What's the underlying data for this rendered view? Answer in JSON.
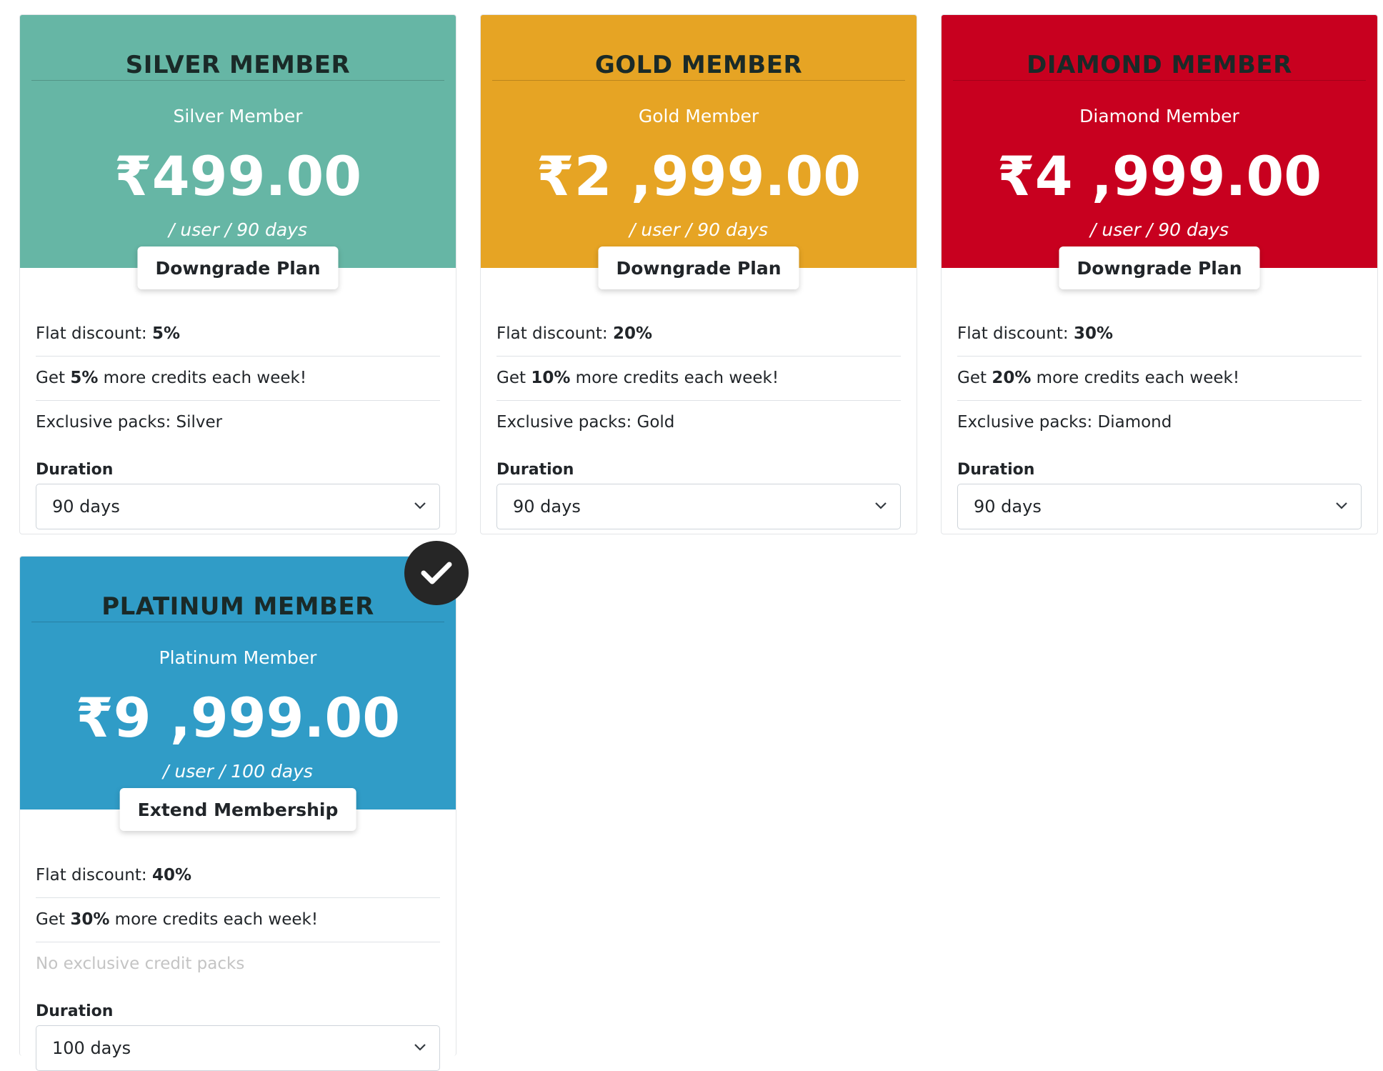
{
  "plans": [
    {
      "title": "SILVER MEMBER",
      "subtitle": "Silver Member",
      "price": "₹499.00",
      "period": "/ user / 90 days",
      "action_label": "Downgrade Plan",
      "accent_color": "#66b6a5",
      "features": [
        {
          "prefix": "Flat discount: ",
          "bold": "5%",
          "suffix": ""
        },
        {
          "prefix": "Get ",
          "bold": "5%",
          "suffix": " more credits each week!"
        },
        {
          "prefix": "Exclusive packs: Silver",
          "bold": "",
          "suffix": ""
        }
      ],
      "duration_label": "Duration",
      "duration_value": "90 days"
    },
    {
      "title": "GOLD MEMBER",
      "subtitle": "Gold Member",
      "price": "₹2 ,999.00",
      "period": "/ user / 90 days",
      "action_label": "Downgrade Plan",
      "accent_color": "#e6a424",
      "features": [
        {
          "prefix": "Flat discount: ",
          "bold": "20%",
          "suffix": ""
        },
        {
          "prefix": "Get ",
          "bold": "10%",
          "suffix": " more credits each week!"
        },
        {
          "prefix": "Exclusive packs: Gold",
          "bold": "",
          "suffix": ""
        }
      ],
      "duration_label": "Duration",
      "duration_value": "90 days"
    },
    {
      "title": "DIAMOND MEMBER",
      "subtitle": "Diamond Member",
      "price": "₹4 ,999.00",
      "period": "/ user / 90 days",
      "action_label": "Downgrade Plan",
      "accent_color": "#c8001f",
      "features": [
        {
          "prefix": "Flat discount: ",
          "bold": "30%",
          "suffix": ""
        },
        {
          "prefix": "Get ",
          "bold": "20%",
          "suffix": " more credits each week!"
        },
        {
          "prefix": "Exclusive packs: Diamond",
          "bold": "",
          "suffix": ""
        }
      ],
      "duration_label": "Duration",
      "duration_value": "90 days"
    },
    {
      "title": "PLATINUM MEMBER",
      "subtitle": "Platinum Member",
      "price": "₹9 ,999.00",
      "period": "/ user / 100 days",
      "action_label": "Extend Membership",
      "accent_color": "#309cc7",
      "features": [
        {
          "prefix": "Flat discount: ",
          "bold": "40%",
          "suffix": ""
        },
        {
          "prefix": "Get ",
          "bold": "30%",
          "suffix": " more credits each week!"
        },
        {
          "prefix": "No exclusive credit packs",
          "bold": "",
          "suffix": ""
        }
      ],
      "duration_label": "Duration",
      "duration_value": "100 days",
      "current": true
    }
  ]
}
